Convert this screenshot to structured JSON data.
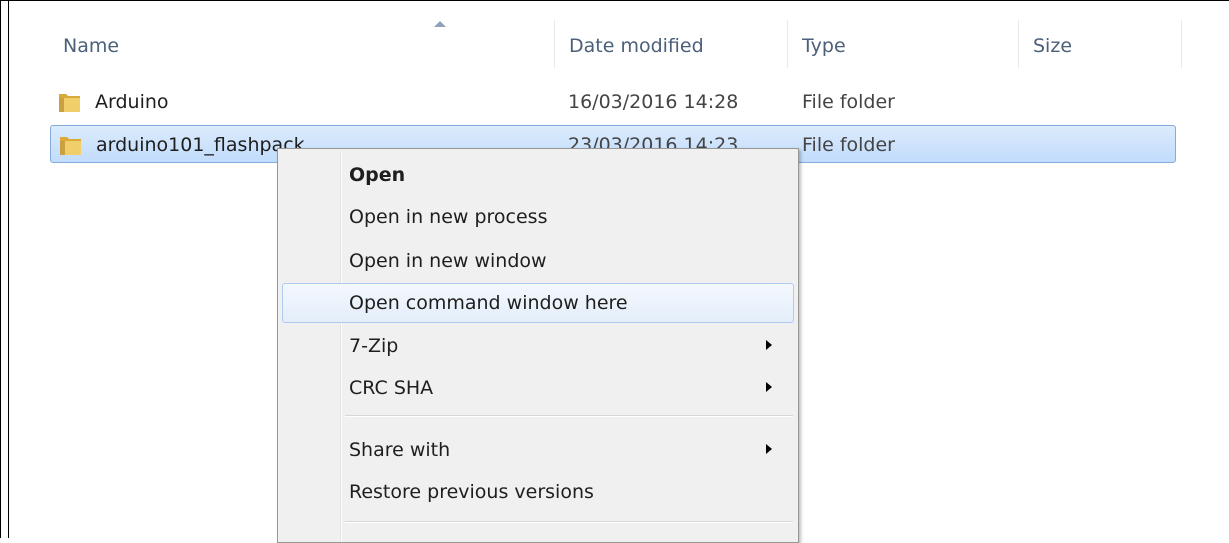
{
  "columns": [
    {
      "label": "Name"
    },
    {
      "label": "Date modified"
    },
    {
      "label": "Type"
    },
    {
      "label": "Size"
    }
  ],
  "rows": [
    {
      "name": "Arduino",
      "date": "16/03/2016 14:28",
      "type": "File folder",
      "size": "",
      "icon": "folder-icon",
      "selected": false
    },
    {
      "name": "arduino101_flashpack",
      "date": "23/03/2016 14:23",
      "type": "File folder",
      "size": "",
      "icon": "folder-icon",
      "selected": true
    }
  ],
  "context_menu": {
    "items": [
      {
        "label": "Open",
        "bold": true,
        "submenu": false
      },
      {
        "label": "Open in new process",
        "bold": false,
        "submenu": false
      },
      {
        "label": "Open in new window",
        "bold": false,
        "submenu": false
      },
      {
        "label": "Open command window here",
        "bold": false,
        "submenu": false,
        "hover": true
      },
      {
        "label": "7-Zip",
        "bold": false,
        "submenu": true
      },
      {
        "label": "CRC SHA",
        "bold": false,
        "submenu": true
      },
      {
        "label": "Share with",
        "bold": false,
        "submenu": true
      },
      {
        "label": "Restore previous versions",
        "bold": false,
        "submenu": false
      }
    ]
  },
  "colors": {
    "header_text": "#4c607a",
    "selection_fill": "#c1dcfc",
    "selection_border": "#84acdd",
    "menu_bg": "#f0f0f0",
    "menu_hover_border": "#aeccf1",
    "folder_yellow": "#e8c45a"
  }
}
